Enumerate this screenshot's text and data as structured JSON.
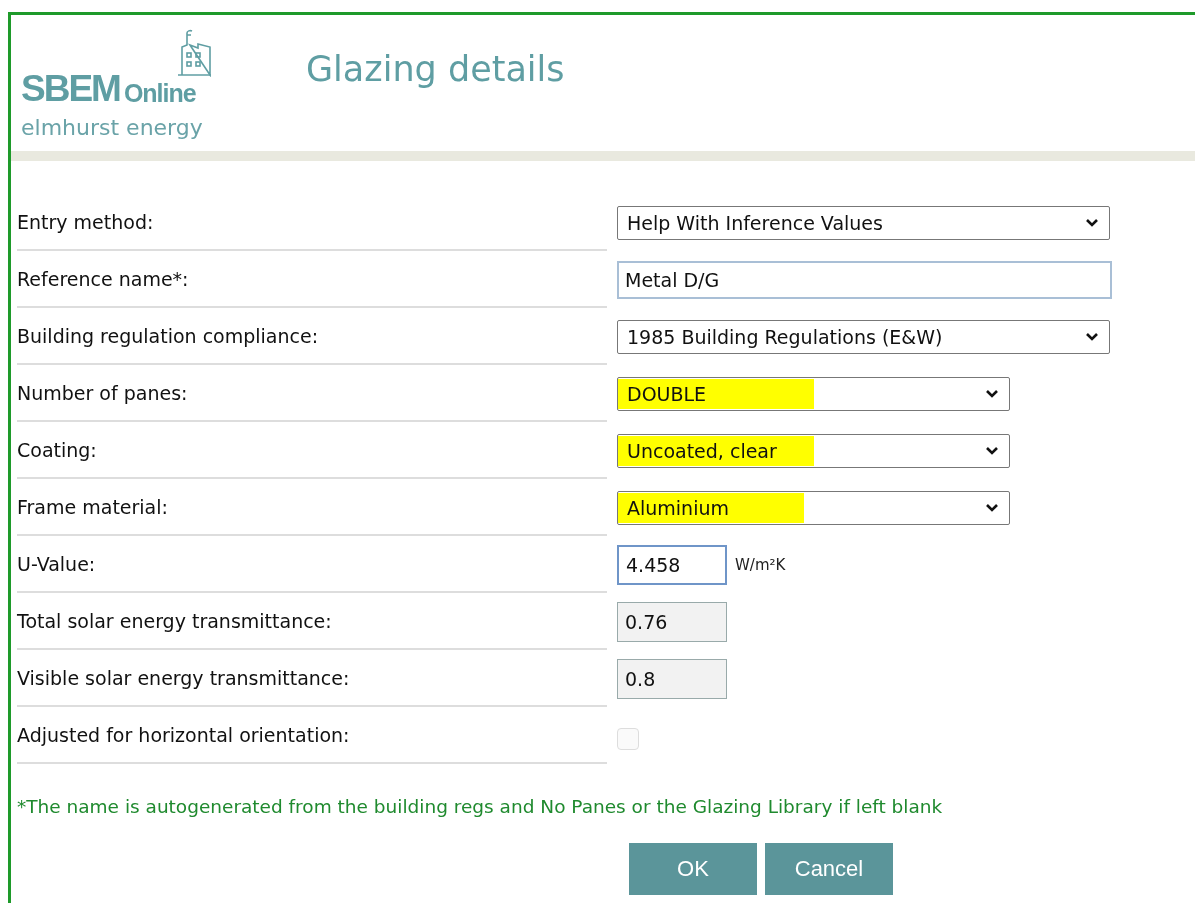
{
  "logo": {
    "brand": "SBEM",
    "product": "Online",
    "company": "elmhurst energy"
  },
  "title": "Glazing details",
  "fields": [
    {
      "label": "Entry method:",
      "kind": "select",
      "value": "Help With Inference Values",
      "highlighted": false
    },
    {
      "label": "Reference name*:",
      "kind": "text",
      "value": "Metal D/G",
      "focused": true
    },
    {
      "label": "Building regulation compliance:",
      "kind": "select",
      "value": "1985 Building Regulations (E&W)",
      "highlighted": false
    },
    {
      "label": "Number of panes:",
      "kind": "select",
      "value": "DOUBLE",
      "highlighted": true
    },
    {
      "label": "Coating:",
      "kind": "select",
      "value": "Uncoated, clear",
      "highlighted": true
    },
    {
      "label": "Frame material:",
      "kind": "select",
      "value": "Aluminium",
      "highlighted": true
    },
    {
      "label": "U-Value:",
      "kind": "number",
      "value": "4.458",
      "unit": "W/m²K",
      "focused": true
    },
    {
      "label": "Total solar energy transmittance:",
      "kind": "number",
      "value": "0.76",
      "focused": false
    },
    {
      "label": "Visible solar energy transmittance:",
      "kind": "number",
      "value": "0.8",
      "focused": false
    },
    {
      "label": "Adjusted for horizontal orientation:",
      "kind": "checkbox",
      "checked": false,
      "disabled": true
    }
  ],
  "note": "*The name is autogenerated from the building regs and No Panes or the Glazing Library if left blank",
  "buttons": [
    "OK",
    "Cancel"
  ]
}
